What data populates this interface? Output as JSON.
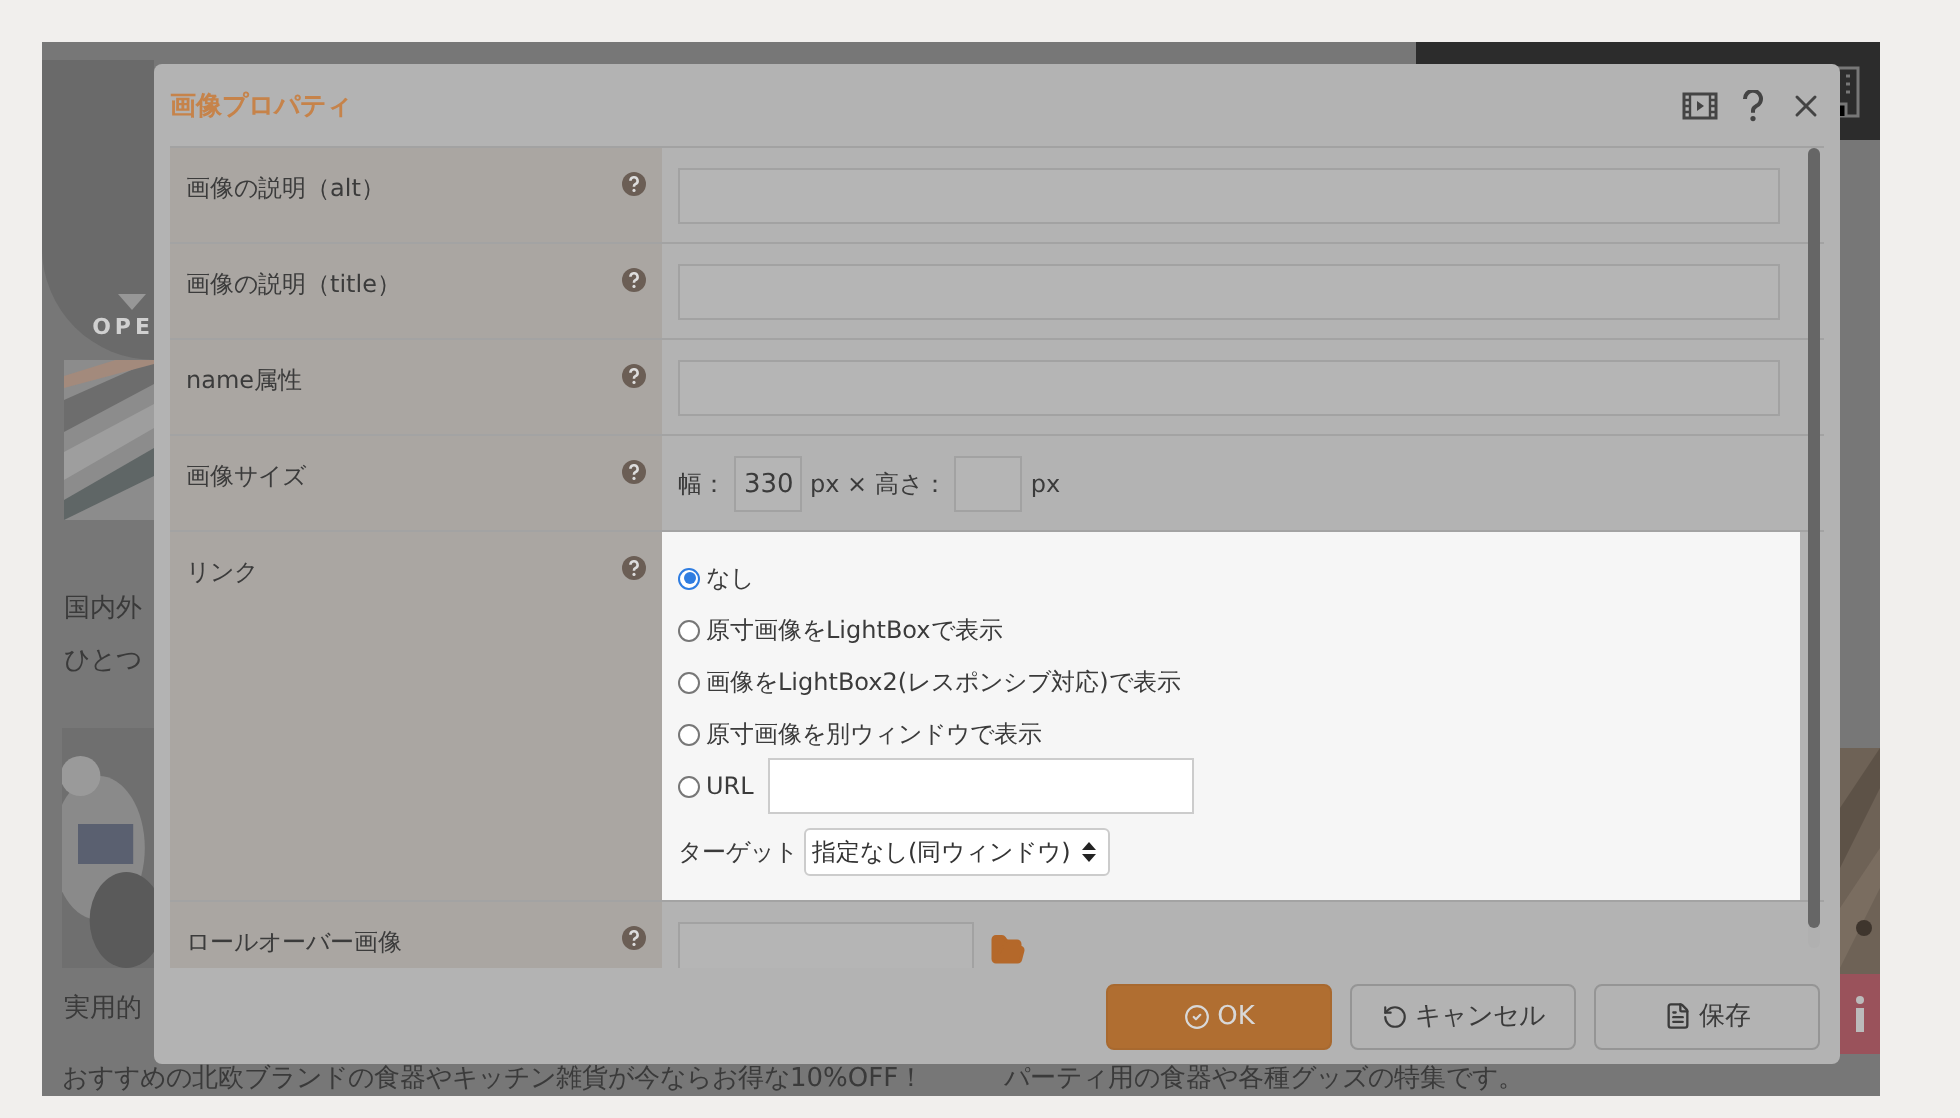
{
  "background_page": {
    "menu_label": "OPE",
    "texts": [
      "国内外",
      "ひとつ",
      "実用的"
    ],
    "footer_texts": [
      "おすすめの北欧ブランドの食器やキッチン雑貨が今ならお得な10%OFF！",
      "パーティ用の食器や各種グッズの特集です。"
    ]
  },
  "dialog": {
    "title": "画像プロパティ",
    "rows": [
      {
        "label": "画像の説明（alt）",
        "kind": "text"
      },
      {
        "label": "画像の説明（title）",
        "kind": "text"
      },
      {
        "label": "name属性",
        "kind": "text"
      },
      {
        "label": "画像サイズ",
        "kind": "size",
        "width_label": "幅：",
        "width_value": "330",
        "middle_label": "px × 高さ：",
        "height_unit": "px"
      },
      {
        "label": "リンク",
        "kind": "link",
        "options": [
          {
            "label": "なし",
            "kind": "plain",
            "selected": true
          },
          {
            "label": "原寸画像をLightBoxで表示",
            "kind": "plain",
            "selected": false
          },
          {
            "label": "画像をLightBox2(レスポンシブ対応)で表示",
            "kind": "plain",
            "selected": false
          },
          {
            "label": "原寸画像を別ウィンドウで表示",
            "kind": "plain",
            "selected": false
          },
          {
            "label": "URL",
            "kind": "url",
            "selected": false
          }
        ],
        "target_label": "ターゲット",
        "target_value": "指定なし(同ウィンドウ)"
      },
      {
        "label": "ロールオーバー画像",
        "kind": "file"
      }
    ],
    "buttons": [
      {
        "label": "OK",
        "kind": "primary"
      },
      {
        "label": "キャンセル",
        "kind": "cancel"
      },
      {
        "label": "保存",
        "kind": "save"
      }
    ]
  }
}
